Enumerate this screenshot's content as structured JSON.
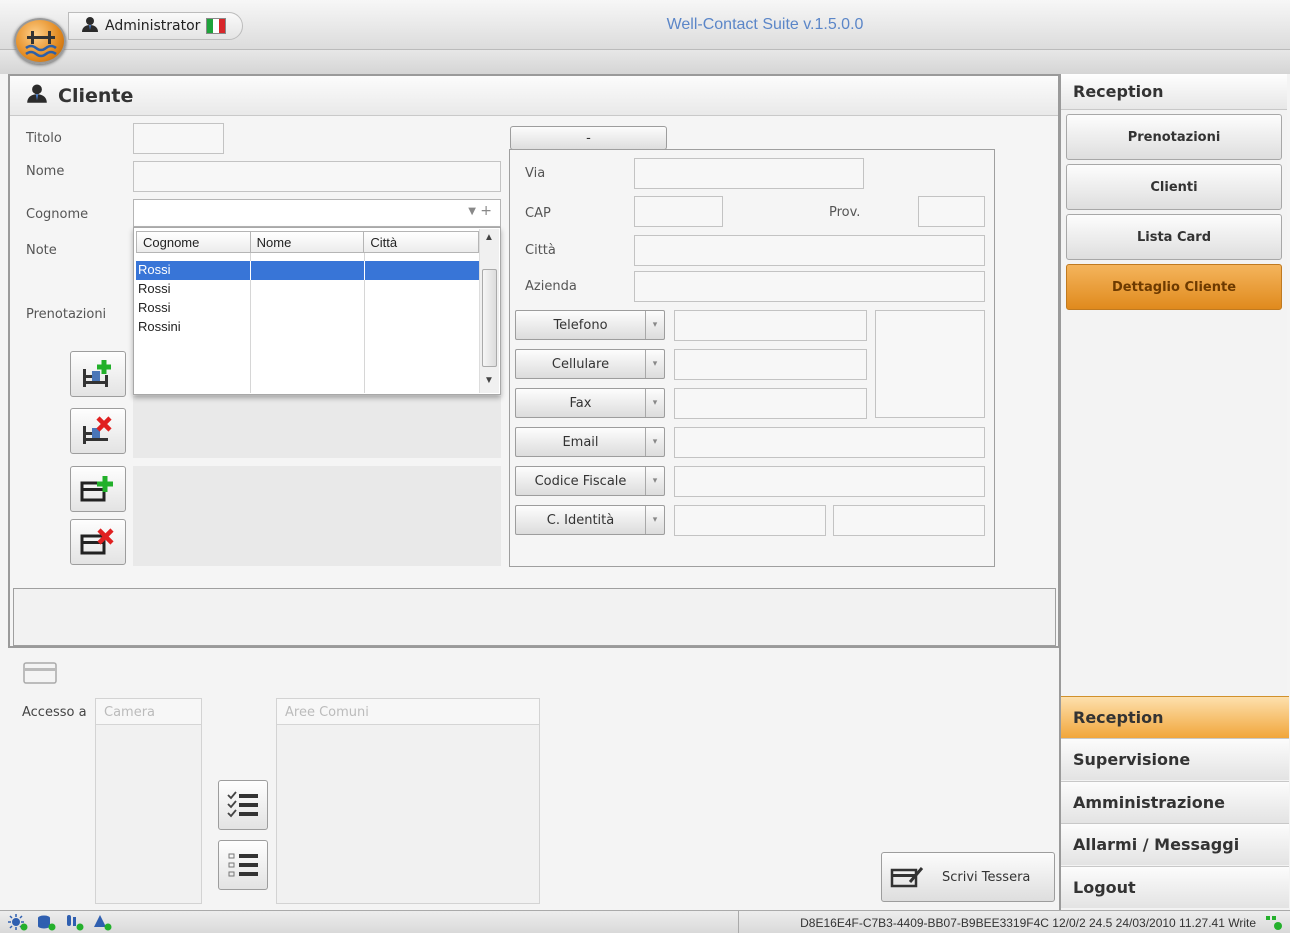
{
  "header": {
    "app_title": "Well-Contact Suite v.1.5.0.0",
    "user": "Administrator"
  },
  "panel": {
    "title": "Cliente",
    "labels": {
      "titolo": "Titolo",
      "nome": "Nome",
      "cognome": "Cognome",
      "note": "Note",
      "prenotazioni": "Prenotazioni",
      "via": "Via",
      "cap": "CAP",
      "prov": "Prov.",
      "citta": "Città",
      "azienda": "Azienda"
    },
    "dash_button": "-",
    "contact_buttons": [
      "Telefono",
      "Cellulare",
      "Fax",
      "Email",
      "Codice Fiscale",
      "C. Identità"
    ]
  },
  "surname_dropdown": {
    "columns": [
      "Cognome",
      "Nome",
      "Città"
    ],
    "rows": [
      {
        "cognome": "Rossi",
        "nome": "",
        "citta": "",
        "selected": true
      },
      {
        "cognome": "Rossi",
        "nome": "",
        "citta": "",
        "selected": false
      },
      {
        "cognome": "Rossi",
        "nome": "",
        "citta": "",
        "selected": false
      },
      {
        "cognome": "Rossini",
        "nome": "",
        "citta": "",
        "selected": false
      }
    ]
  },
  "access": {
    "label": "Accesso a",
    "camera_header": "Camera",
    "aree_header": "Aree Comuni",
    "write_card_button": "Scrivi Tessera"
  },
  "right_panel": {
    "section_title": "Reception",
    "buttons": [
      "Prenotazioni",
      "Clienti",
      "Lista Card",
      "Dettaglio Cliente"
    ],
    "active_button": "Dettaglio Cliente",
    "nav": [
      "Reception",
      "Supervisione",
      "Amministrazione",
      "Allarmi / Messaggi",
      "Logout"
    ],
    "active_nav": "Reception"
  },
  "status_bar": {
    "text": "D8E16E4F-C7B3-4409-BB07-B9BEE3319F4C 12/0/2 24.5 24/03/2010 11.27.41 Write"
  },
  "colors": {
    "accent_orange": "#e8962a",
    "title_blue": "#5b86c8",
    "selection_blue": "#3875d7",
    "add_green": "#22b02a",
    "remove_red": "#e02020"
  }
}
